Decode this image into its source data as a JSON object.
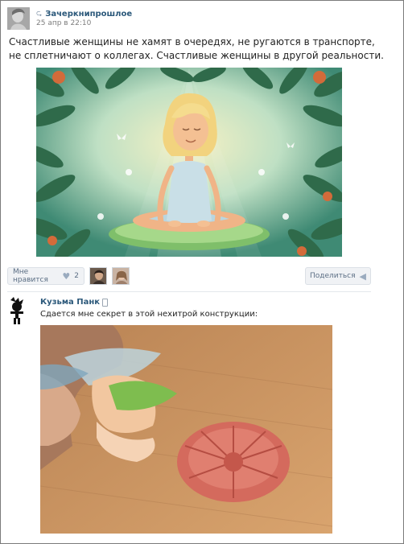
{
  "post": {
    "author": "Зачеркнипрошлое",
    "date": "25 апр в 22:10",
    "text": "Счастливые женщины не хамят в очередях, не ругаются в транспорте, не сплетничают о коллегах. Счастливые женщины в другой реальности.",
    "image_icon": "illustration-meditating-woman"
  },
  "actions": {
    "like_label": "Мне нравится",
    "like_count": "2",
    "like_icon": "heart-icon",
    "share_label": "Поделиться",
    "share_icon": "megaphone-icon"
  },
  "comment": {
    "author": "Кузьма Панк",
    "text": "Сдается мне секрет в этой нехитрой конструкции:",
    "image_icon": "photo-toy-fairy-and-flower"
  },
  "colors": {
    "link": "#2b587a",
    "button_bg": "#f0f2f5",
    "muted": "#7d7d7d"
  }
}
